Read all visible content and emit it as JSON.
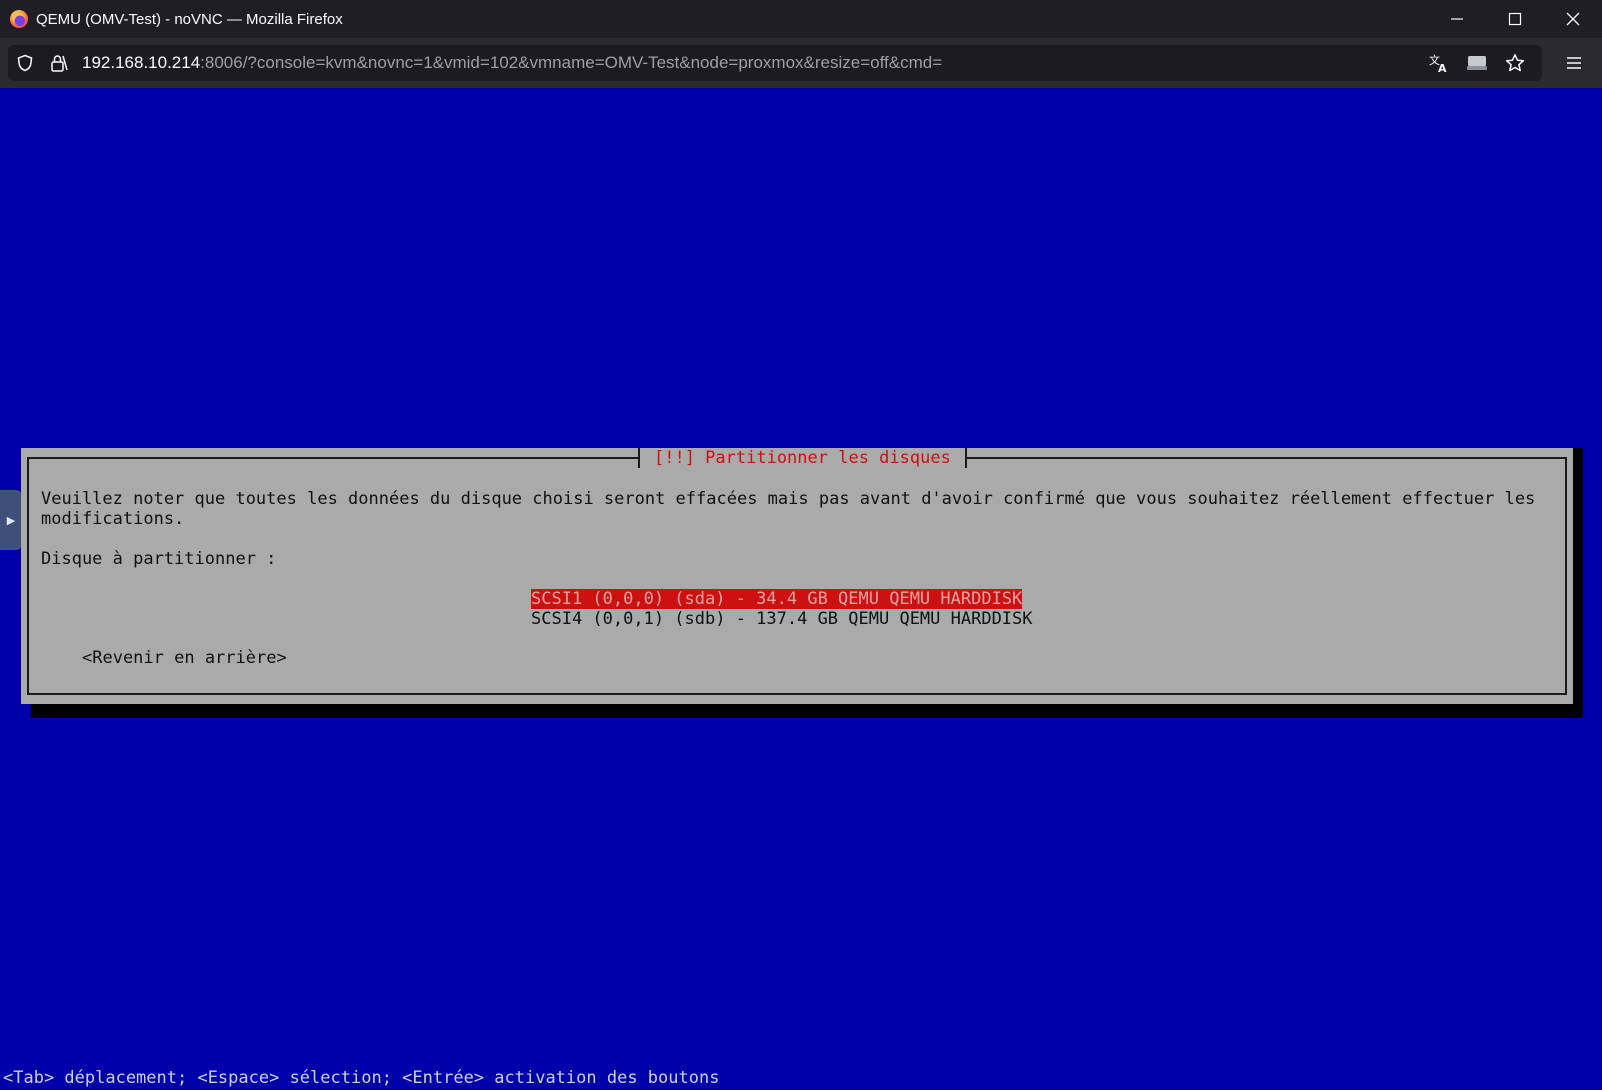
{
  "browser": {
    "title": "QEMU (OMV-Test) - noVNC — Mozilla Firefox",
    "url_host": "192.168.10.214",
    "url_rest": ":8006/?console=kvm&novnc=1&vmid=102&vmname=OMV-Test&node=proxmox&resize=off&cmd=",
    "icons": [
      "firefox-logo",
      "shield-icon",
      "lock-icon",
      "translate-icon",
      "screen-share-icon",
      "star-icon",
      "menu-icon",
      "minimize-icon",
      "maximize-icon",
      "close-icon"
    ]
  },
  "installer": {
    "dialog_title": "[!!] Partitionner les disques",
    "message_line1": "Veuillez noter que toutes les données du disque choisi seront effacées mais pas avant d'avoir confirmé que vous souhaitez réellement effectuer les",
    "message_line2": "modifications.",
    "prompt": "Disque à partitionner :",
    "disks": [
      "SCSI1 (0,0,0) (sda) - 34.4 GB QEMU QEMU HARDDISK",
      "SCSI4 (0,0,1) (sdb) - 137.4 GB QEMU QEMU HARDDISK"
    ],
    "selected_disk_index": 0,
    "back_button": "<Revenir en arrière>",
    "status_line": "<Tab> déplacement; <Espace> sélection; <Entrée> activation des boutons"
  },
  "colors": {
    "screen_background": "#0000aa",
    "dialog_background": "#aaaaaa",
    "title_color": "#cc1111",
    "selection_background": "#cc1111"
  }
}
